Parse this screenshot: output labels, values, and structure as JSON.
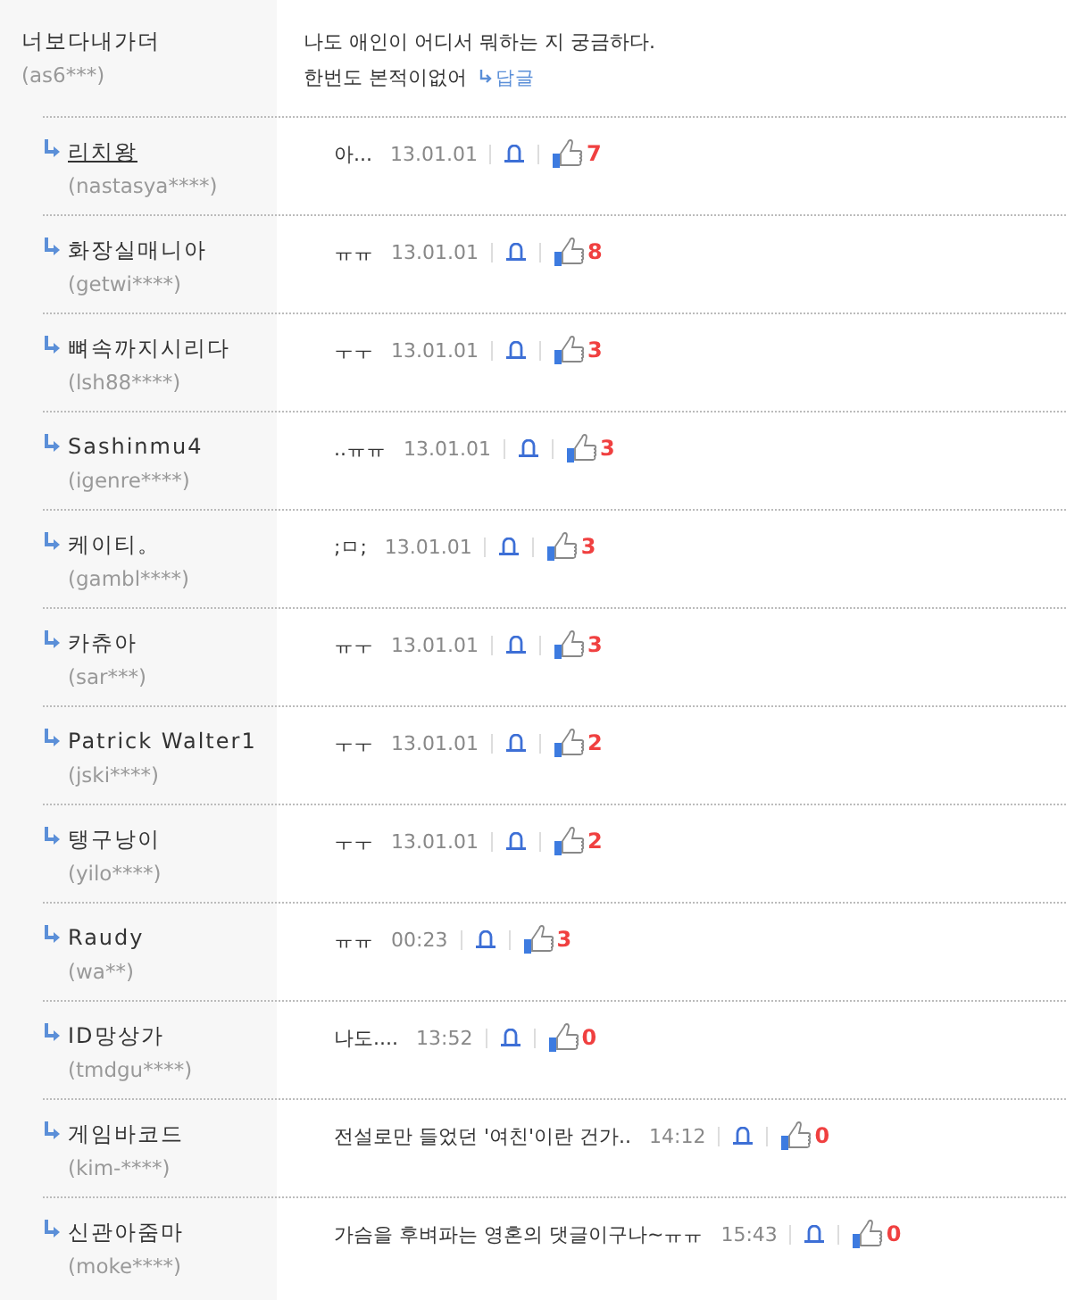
{
  "comment": {
    "name": "너보다내가더",
    "user_id": "(as6***)",
    "lines": [
      "나도 애인이 어디서 뭐하는 지 궁금하다.",
      "한번도 본적이없어"
    ],
    "reply_link": "답글"
  },
  "replies": [
    {
      "name": "리치왕",
      "user_id": "(nastasya****)",
      "text": "아...",
      "time": "13.01.01",
      "likes": "7",
      "underlined": true
    },
    {
      "name": "화장실매니아",
      "user_id": "(getwi****)",
      "text": "ㅠㅠ",
      "time": "13.01.01",
      "likes": "8",
      "underlined": false
    },
    {
      "name": "뼈속까지시리다",
      "user_id": "(lsh88****)",
      "text": "ㅜㅜ",
      "time": "13.01.01",
      "likes": "3",
      "underlined": false
    },
    {
      "name": "Sashinmu4",
      "user_id": "(igenre****)",
      "text": "..ㅠㅠ",
      "time": "13.01.01",
      "likes": "3",
      "underlined": false
    },
    {
      "name": "케이티。",
      "user_id": "(gambl****)",
      "text": ";ㅁ;",
      "time": "13.01.01",
      "likes": "3",
      "underlined": false
    },
    {
      "name": "카츄아",
      "user_id": "(sar***)",
      "text": "ㅠㅜ",
      "time": "13.01.01",
      "likes": "3",
      "underlined": false
    },
    {
      "name": "Patrick Walter1",
      "user_id": "(jski****)",
      "text": "ㅜㅜ",
      "time": "13.01.01",
      "likes": "2",
      "underlined": false
    },
    {
      "name": "탱구낭이",
      "user_id": "(yilo****)",
      "text": "ㅜㅜ",
      "time": "13.01.01",
      "likes": "2",
      "underlined": false
    },
    {
      "name": "Raudy",
      "user_id": "(wa**)",
      "text": "ㅠㅠ",
      "time": "00:23",
      "likes": "3",
      "underlined": false
    },
    {
      "name": "ID망상가",
      "user_id": "(tmdgu****)",
      "text": "나도....",
      "time": "13:52",
      "likes": "0",
      "underlined": false
    },
    {
      "name": "게임바코드",
      "user_id": "(kim-****)",
      "text": "전설로만 들었던 '여친'이란 건가..",
      "time": "14:12",
      "likes": "0",
      "underlined": false
    },
    {
      "name": "신관아줌마",
      "user_id": "(moke****)",
      "text": "가슴을 후벼파는 영혼의 댓글이구나~ㅠㅠ",
      "time": "15:43",
      "likes": "0",
      "underlined": false
    }
  ]
}
